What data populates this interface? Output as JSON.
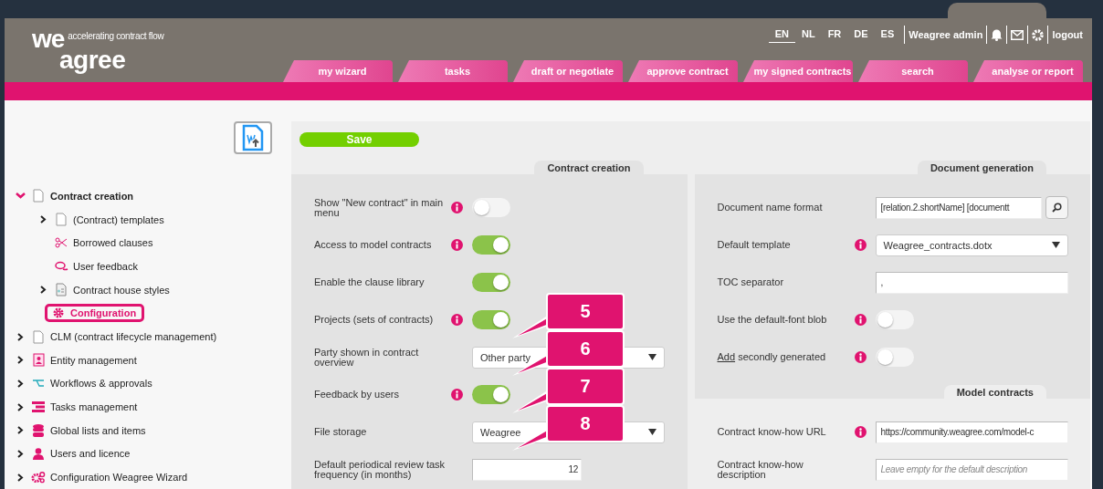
{
  "header": {
    "logo": {
      "line1": "we",
      "line2": "agree",
      "tagline": "accelerating contract flow"
    },
    "languages": [
      {
        "label": "EN",
        "selected": true
      },
      {
        "label": "NL",
        "selected": false
      },
      {
        "label": "FR",
        "selected": false
      },
      {
        "label": "DE",
        "selected": false
      },
      {
        "label": "ES",
        "selected": false
      }
    ],
    "user": "Weagree admin",
    "logout": "logout",
    "tabs": [
      {
        "label": "my wizard"
      },
      {
        "label": "tasks"
      },
      {
        "label": "draft or negotiate"
      },
      {
        "label": "approve contract"
      },
      {
        "label": "my signed contracts"
      },
      {
        "label": "search"
      },
      {
        "label": "analyse or report"
      }
    ]
  },
  "sidebar": {
    "items": [
      {
        "label": "Contract creation",
        "kind": "branch",
        "expanded": true,
        "selected": false,
        "children": [
          {
            "label": "(Contract) templates",
            "kind": "branch",
            "expanded": false,
            "selected": false
          },
          {
            "label": "Borrowed clauses",
            "kind": "leaf",
            "selected": false
          },
          {
            "label": "User feedback",
            "kind": "leaf",
            "selected": false
          },
          {
            "label": "Contract house styles",
            "kind": "branch",
            "expanded": false,
            "selected": false
          },
          {
            "label": "Configuration",
            "kind": "leaf",
            "selected": true
          }
        ]
      },
      {
        "label": "CLM (contract lifecycle management)",
        "kind": "branch",
        "expanded": false,
        "selected": false
      },
      {
        "label": "Entity management",
        "kind": "branch",
        "expanded": false,
        "selected": false
      },
      {
        "label": "Workflows & approvals",
        "kind": "branch",
        "expanded": false,
        "selected": false
      },
      {
        "label": "Tasks management",
        "kind": "branch",
        "expanded": false,
        "selected": false
      },
      {
        "label": "Global lists and items",
        "kind": "branch",
        "expanded": false,
        "selected": false
      },
      {
        "label": "Users and licence",
        "kind": "branch",
        "expanded": false,
        "selected": false
      },
      {
        "label": "Configuration Weagree Wizard",
        "kind": "branch",
        "expanded": false,
        "selected": false
      }
    ]
  },
  "save_button": "Save",
  "columns": [
    {
      "sections": [
        {
          "title": "Contract creation",
          "rows": [
            {
              "label": "Show \"New contract\" in main menu",
              "info": true,
              "kind": "toggle",
              "on": false
            },
            {
              "label": "Access to model contracts",
              "info": true,
              "kind": "toggle",
              "on": true
            },
            {
              "label": "Enable the clause library",
              "info": false,
              "kind": "toggle",
              "on": true
            },
            {
              "label": "Projects (sets of contracts)",
              "info": true,
              "kind": "toggle",
              "on": true
            },
            {
              "label": "Party shown in contract overview",
              "info": false,
              "kind": "select",
              "value": "Other party"
            },
            {
              "label": "Feedback by users",
              "info": true,
              "kind": "toggle",
              "on": true
            },
            {
              "label": "File storage",
              "info": false,
              "kind": "select",
              "value": "Weagree"
            },
            {
              "label": "Default periodical review task frequency (in months)",
              "info": false,
              "kind": "number",
              "value": "12"
            }
          ]
        }
      ]
    },
    {
      "sections": [
        {
          "title": "Document generation",
          "rows": [
            {
              "label": "Document name format",
              "info": false,
              "kind": "search",
              "value": "[relation.2.shortName] [documentt"
            },
            {
              "label": "Default template",
              "info": true,
              "kind": "select",
              "value": "Weagree_contracts.dotx"
            },
            {
              "label": "TOC separator",
              "info": false,
              "kind": "text",
              "value": ","
            },
            {
              "label": "Use the default-font blob",
              "info": true,
              "kind": "toggle",
              "on": false
            },
            {
              "link": "Add",
              "label": "secondly generated",
              "info": true,
              "kind": "toggle",
              "on": false
            }
          ]
        },
        {
          "title": "Model contracts",
          "rows": [
            {
              "label": "Contract know-how URL",
              "info": true,
              "kind": "text",
              "value": "https://community.weagree.com/model-c"
            },
            {
              "label": "Contract know-how description",
              "info": false,
              "kind": "text",
              "placeholder": "Leave empty for the default description"
            }
          ]
        }
      ]
    }
  ],
  "callouts": [
    "5",
    "6",
    "7",
    "8"
  ]
}
